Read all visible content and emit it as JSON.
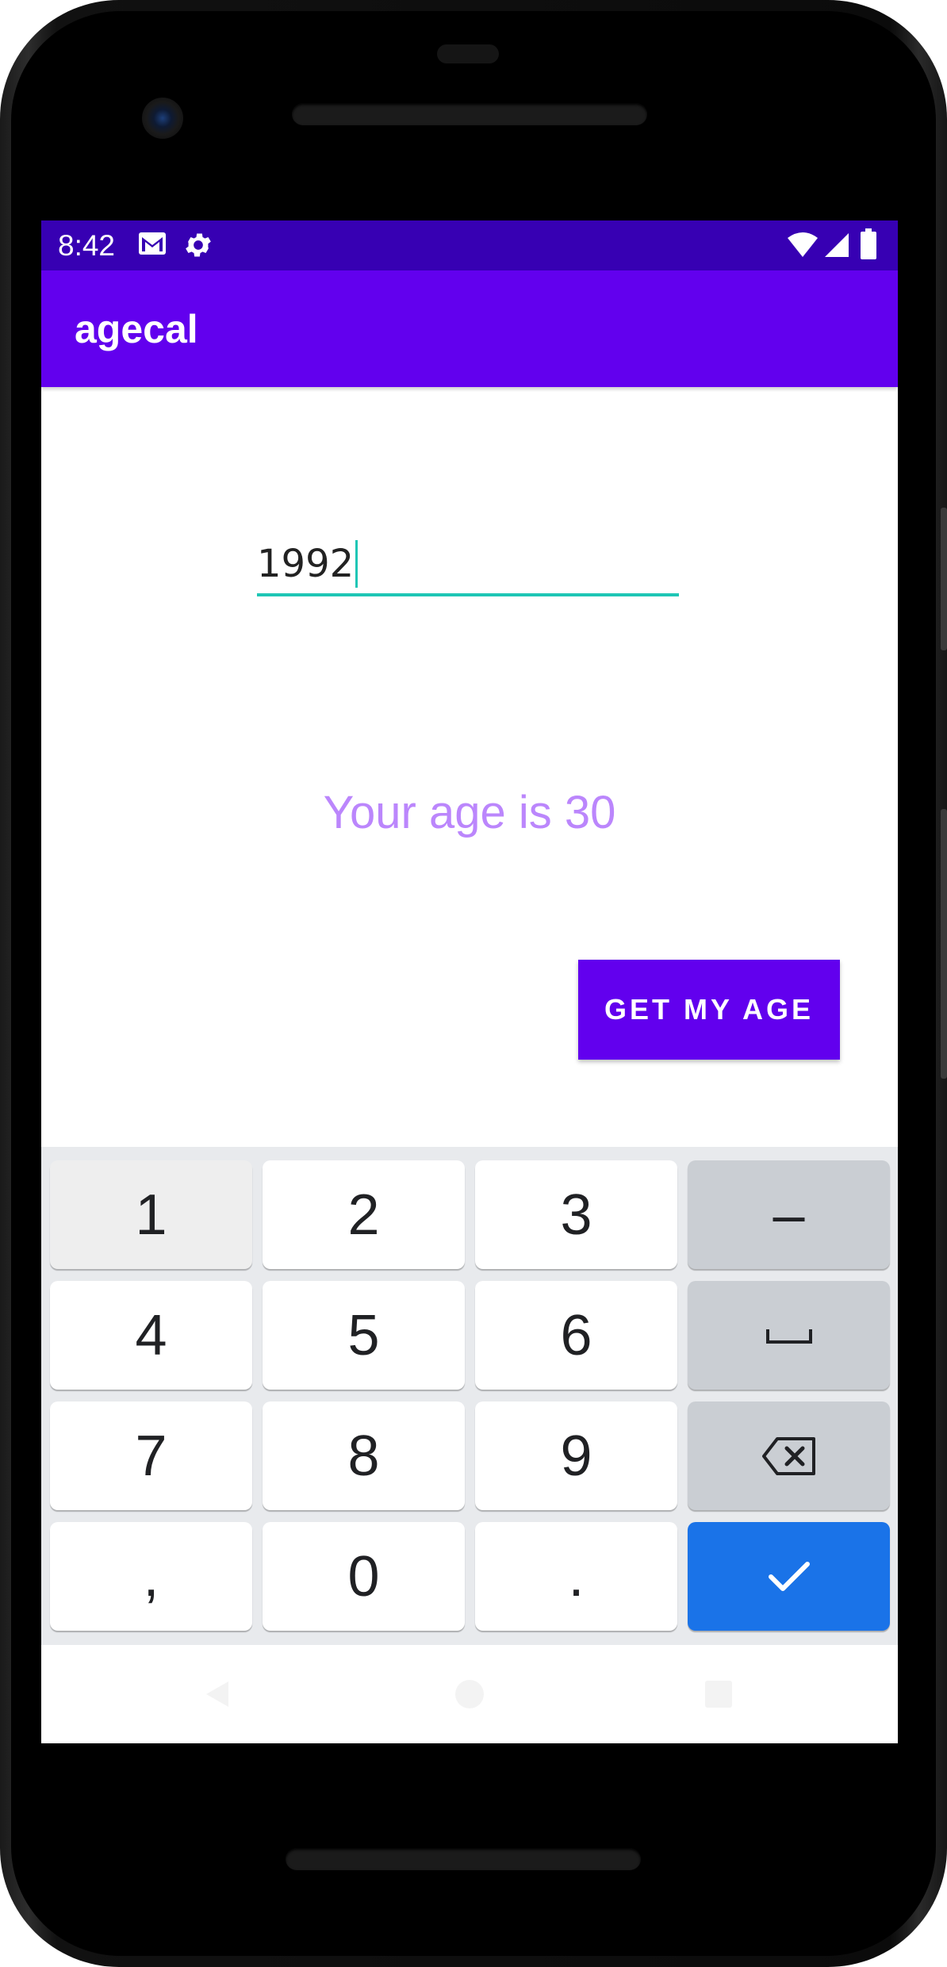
{
  "status_bar": {
    "time": "8:42",
    "left_icons": [
      "gmail-icon",
      "settings-gear-icon"
    ],
    "right_icons": [
      "wifi-icon",
      "cell-signal-icon",
      "battery-icon"
    ],
    "background": "#3700b3"
  },
  "app_bar": {
    "title": "agecal",
    "background": "#6200ee"
  },
  "year_input": {
    "value": "1992",
    "accent": "#1ec6b5"
  },
  "result": {
    "text": "Your age is 30",
    "color": "#bb86fc"
  },
  "action_button": {
    "label": "GET MY AGE",
    "background": "#6200ee"
  },
  "keyboard": {
    "rows": [
      [
        "1",
        "2",
        "3",
        "–"
      ],
      [
        "4",
        "5",
        "6",
        "space"
      ],
      [
        "7",
        "8",
        "9",
        "backspace"
      ],
      [
        ",",
        "0",
        ".",
        "done"
      ]
    ],
    "labels": {
      "k1": "1",
      "k2": "2",
      "k3": "3",
      "dash": "–",
      "k4": "4",
      "k5": "5",
      "k6": "6",
      "k7": "7",
      "k8": "8",
      "k9": "9",
      "comma": ",",
      "k0": "0",
      "period": "."
    },
    "enter_color": "#1a73e8"
  },
  "nav_bar": {
    "items": [
      "back-icon",
      "home-icon",
      "recents-icon"
    ]
  }
}
